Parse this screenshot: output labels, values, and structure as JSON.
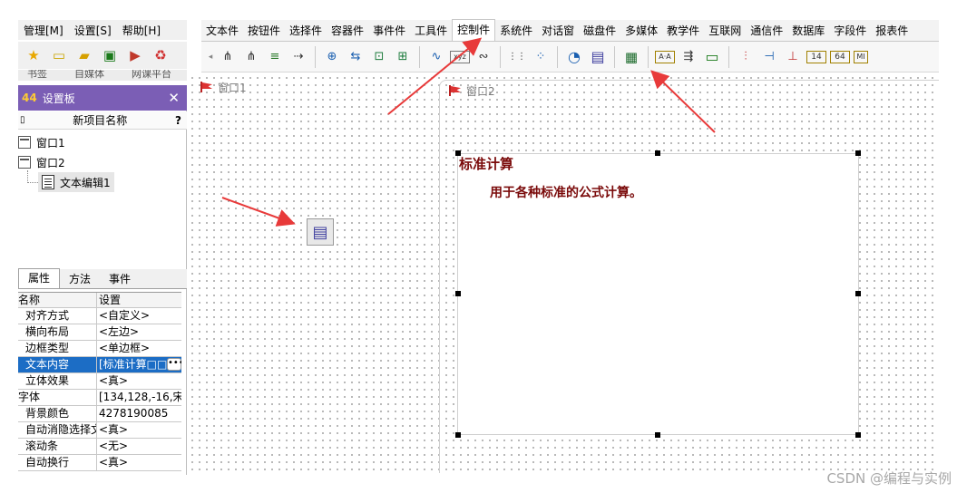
{
  "menu": {
    "items": [
      "管理[M]",
      "设置[S]",
      "帮助[H]"
    ]
  },
  "left_toolbar": {
    "icons": [
      "star-icon",
      "window-icon",
      "folder-icon",
      "save-icon",
      "run-icon",
      "recycle-icon"
    ]
  },
  "bookmarks": [
    "书签",
    "自媒体",
    "网课平台"
  ],
  "tabs": [
    "文本件",
    "按钮件",
    "选择件",
    "容器件",
    "事件件",
    "工具件",
    "控制件",
    "系统件",
    "对话窗",
    "磁盘件",
    "多媒体",
    "教学件",
    "互联网",
    "通信件",
    "数据库",
    "字段件",
    "报表件"
  ],
  "active_tab": "控制件",
  "control_icons": [
    {
      "name": "tree-node-icon",
      "glyph": "⋔"
    },
    {
      "name": "tree-branch-icon",
      "glyph": "⋔"
    },
    {
      "name": "list-tree-icon",
      "glyph": "≡"
    },
    {
      "name": "connector-icon",
      "glyph": "⇢"
    },
    {
      "name": "crosshair-icon",
      "glyph": "⊕"
    },
    {
      "name": "flow-icon",
      "glyph": "⇆"
    },
    {
      "name": "box-arrow-icon",
      "glyph": "⊡"
    },
    {
      "name": "box-link-icon",
      "glyph": "⊞"
    },
    {
      "name": "wave-icon",
      "glyph": "∿"
    },
    {
      "name": "xyz-icon",
      "glyph": "xyz"
    },
    {
      "name": "scope-icon",
      "glyph": "∾"
    },
    {
      "name": "binary-grid-icon",
      "glyph": "⋮⋮"
    },
    {
      "name": "dot-matrix-icon",
      "glyph": "⁘"
    },
    {
      "name": "disk-chart-icon",
      "glyph": "◔"
    },
    {
      "name": "document-box-icon",
      "glyph": "▤"
    },
    {
      "name": "calendar-icon",
      "glyph": "▦"
    },
    {
      "name": "ab-box-icon",
      "glyph": "A·A"
    },
    {
      "name": "switch-list-icon",
      "glyph": "⇶"
    },
    {
      "name": "bus-icon",
      "glyph": "▭"
    },
    {
      "name": "ruler-icon",
      "glyph": "⫶"
    },
    {
      "name": "slider-icon",
      "glyph": "⊣"
    },
    {
      "name": "scale-icon",
      "glyph": "⊥"
    },
    {
      "name": "counter-14-icon",
      "glyph": "14"
    },
    {
      "name": "counter-64-icon",
      "glyph": "64"
    },
    {
      "name": "mid-icon",
      "glyph": "MI"
    }
  ],
  "windows": {
    "win1_title": "窗口1",
    "win2_title": "窗口2"
  },
  "textbox": {
    "title": "标准计算",
    "body": "用于各种标准的公式计算。"
  },
  "panel": {
    "title": "设置板",
    "subhead": "新项目名称",
    "help": "?",
    "tree": {
      "node1": "窗口1",
      "node2": "窗口2",
      "child": "文本编辑1"
    },
    "prop_tabs": [
      "属性",
      "方法",
      "事件"
    ],
    "prop_headers": {
      "name": "名称",
      "value": "设置"
    },
    "properties": [
      {
        "name": "对齐方式",
        "value": "<自定义>"
      },
      {
        "name": "横向布局",
        "value": "<左边>"
      },
      {
        "name": "边框类型",
        "value": "<单边框>"
      },
      {
        "name": "文本内容",
        "value": "[标准计算□□"
      },
      {
        "name": "立体效果",
        "value": "<真>"
      },
      {
        "name": "字体",
        "value": "[134,128,-16,宋"
      },
      {
        "name": "背景颜色",
        "value": "4278190085"
      },
      {
        "name": "自动消隐选择文",
        "value": "<真>"
      },
      {
        "name": "滚动条",
        "value": "<无>"
      },
      {
        "name": "自动换行",
        "value": "<真>"
      }
    ]
  },
  "colors": {
    "panel_header": "#7b5eb5",
    "selection": "#1c6dc5",
    "text_dark_red": "#7a0a0a",
    "arrow_red": "#e83a3a"
  },
  "watermark": "CSDN @编程与实例"
}
